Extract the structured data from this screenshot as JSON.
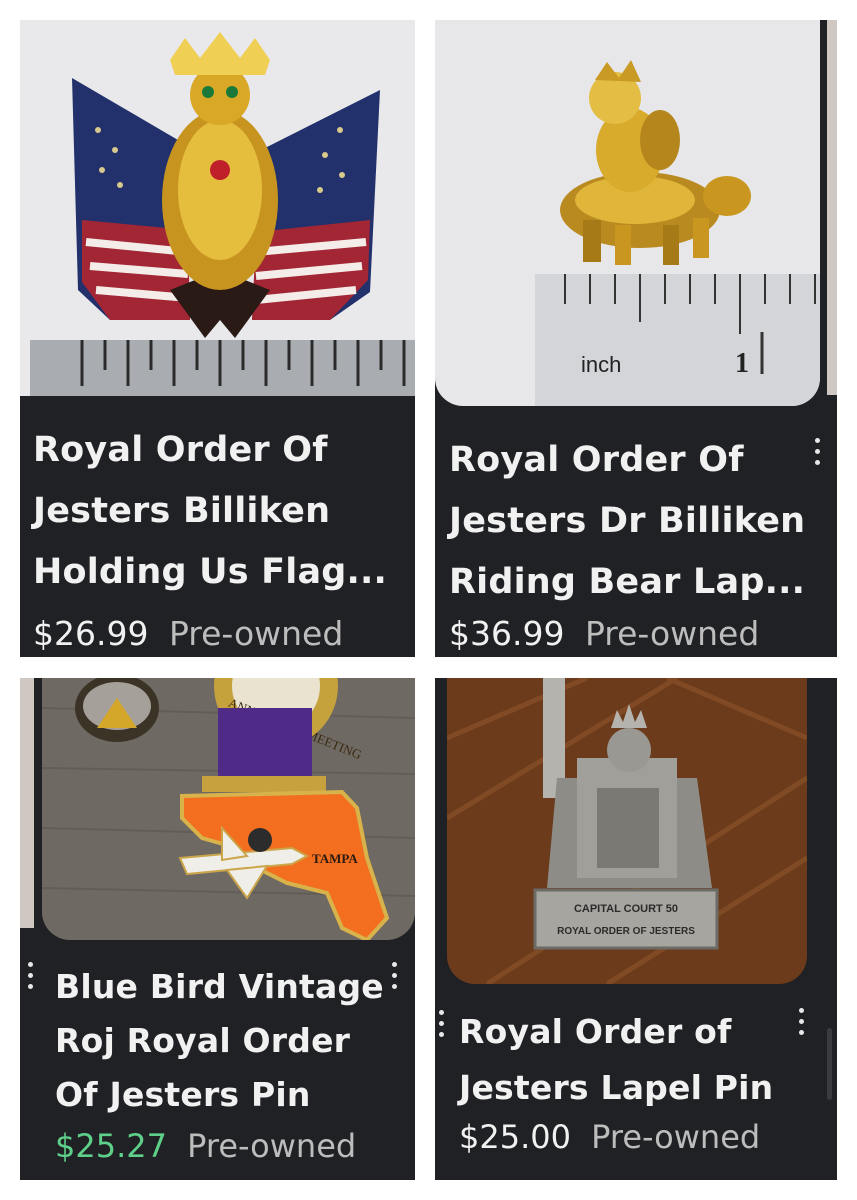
{
  "listings": [
    {
      "title_lines": [
        "Royal Order Of",
        "Jesters Billiken",
        "Holding Us Flag..."
      ],
      "price": "$26.99",
      "condition": "Pre-owned"
    },
    {
      "title_lines": [
        "Royal Order Of",
        "Jesters Dr Billiken",
        "Riding Bear Lap..."
      ],
      "price": "$36.99",
      "condition": "Pre-owned",
      "photo_text": {
        "ruler_unit": "inch",
        "ruler_number": "1"
      }
    },
    {
      "title_lines": [
        "Blue Bird Vintage",
        "Roj Royal Order",
        "Of Jesters Pin"
      ],
      "price": "$25.27",
      "condition": "Pre-owned",
      "photo_text": {
        "ribbon_text": "ANNUAL ROJ MEETING",
        "map_label": "TAMPA"
      }
    },
    {
      "title_lines": [
        "Royal Order of",
        "Jesters Lapel Pin"
      ],
      "price": "$25.00",
      "condition": "Pre-owned",
      "photo_text": {
        "plaque_line1": "CAPITAL COURT 50",
        "plaque_line2": "ROYAL ORDER OF JESTERS"
      }
    }
  ],
  "colors": {
    "card_bg": "#202124",
    "title_text": "#f1f1f1",
    "condition_text": "#bdbdbd",
    "price_green": "#5ed08a"
  },
  "icons": {
    "more_options": "more-vert-icon"
  }
}
